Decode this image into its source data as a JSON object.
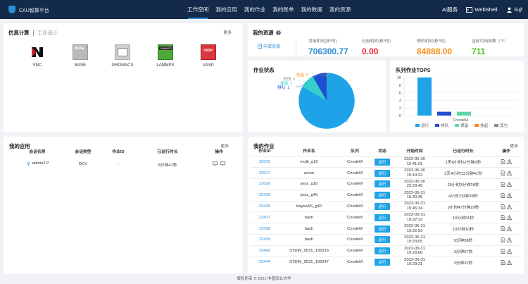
{
  "header": {
    "brand": "CAU智算平台",
    "nav": [
      "工作空间",
      "我的应用",
      "我的作业",
      "我的账单",
      "我的数据",
      "我的资源"
    ],
    "ai_service": "AI服务",
    "webshell": "WebShell",
    "user": "liujf"
  },
  "simulation": {
    "tab_active": "仿真计算",
    "tab_inactive": "工业设计",
    "more": "更多",
    "apps": [
      {
        "name": "VNC",
        "icon": "vnc-icon"
      },
      {
        "name": "BASE",
        "icon": "base-icon"
      },
      {
        "name": "GROMACS",
        "icon": "gromacs-icon"
      },
      {
        "name": "LAMMPS",
        "icon": "lammps-icon"
      },
      {
        "name": "VASP",
        "icon": "vasp-icon"
      }
    ],
    "base_badge": "BASE",
    "lammps_badge": "LAMMPS",
    "vasp_badge": "VASP"
  },
  "resources": {
    "title": "我的资源",
    "apply_link": "申请资源",
    "stats": [
      {
        "label": "可用机时(核*时)",
        "value": "706300.77",
        "color": "#2e8fd8"
      },
      {
        "label": "已用机时(核*时)",
        "value": "0.00",
        "color": "#f5222d"
      },
      {
        "label": "预约机时(核*时)",
        "value": "84888.00",
        "color": "#fa8c16"
      },
      {
        "label": "当前可用核数（个）",
        "value": "711",
        "color": "#52c41a"
      }
    ]
  },
  "job_status": {
    "title": "作业状态",
    "labels": [
      "挂起: 0",
      "其他: 0",
      "保留: 1",
      "排队: 1",
      "运行: 10"
    ],
    "colors": {
      "running": "#1fa3e8",
      "queued": "#1f4fd1",
      "reserved": "#36cfc9",
      "held": "#fa8c16",
      "other": "#8c8c8c"
    }
  },
  "queue_chart": {
    "title": "队列作业TOPS",
    "chart_data": {
      "type": "bar",
      "categories": [
        "CnodeM"
      ],
      "series": [
        {
          "name": "运行",
          "values": [
            10
          ],
          "color": "#1fa3e8"
        },
        {
          "name": "排队",
          "values": [
            1
          ],
          "color": "#1f4fd1"
        },
        {
          "name": "保留",
          "values": [
            1
          ],
          "color": "#5fd6a8"
        },
        {
          "name": "挂起",
          "values": [
            0
          ],
          "color": "#fa8c16"
        },
        {
          "name": "其它",
          "values": [
            0
          ],
          "color": "#8c8c8c"
        }
      ],
      "yticks": [
        "10",
        "8",
        "6",
        "4",
        "2",
        "0"
      ],
      "ylim": [
        0,
        10
      ]
    }
  },
  "my_apps": {
    "title": "我的应用",
    "more": "更多",
    "columns": [
      "会话名称",
      "会话类型",
      "作业ID",
      "已运行时长",
      "操作"
    ],
    "rows": [
      {
        "name": "admin2:2",
        "type": "DCV",
        "job_id": "-",
        "elapsed": "5分钟41秒"
      }
    ]
  },
  "my_jobs": {
    "title": "我的作业",
    "more": "更多",
    "columns": [
      "作业ID",
      "作业名",
      "队列",
      "状态",
      "开始时间",
      "已运行时长",
      "操作"
    ],
    "rows": [
      {
        "id": "22015",
        "name": "multi_g10",
        "queue": "CnodeM",
        "status": "运行",
        "start": "2022-05-30\n12:41:01",
        "elapsed": "1天6小时52分钟2秒"
      },
      {
        "id": "22017",
        "name": "union",
        "queue": "CnodeM",
        "status": "运行",
        "start": "2022-05-30\n15:19:22",
        "elapsed": "1天4小时13分钟41秒"
      },
      {
        "id": "23026",
        "name": "jwas_g10",
        "queue": "CnodeM",
        "status": "运行",
        "start": "2022-05-30\n23:29:45",
        "elapsed": "20小时3分钟18秒"
      },
      {
        "id": "23429",
        "name": "jwas_g40",
        "queue": "CnodeM",
        "status": "运行",
        "start": "2022-05-31\n15:30:35",
        "elapsed": "4小时2分钟28秒"
      },
      {
        "id": "23430",
        "name": "bayesAS_g40",
        "queue": "CnodeM",
        "status": "运行",
        "start": "2022-05-31\n15:45:34",
        "elapsed": "3小时47分钟29秒"
      },
      {
        "id": "23437",
        "name": "bash",
        "queue": "CnodeM",
        "status": "运行",
        "start": "2022-05-31\n19:22:32",
        "elapsed": "10分钟31秒"
      },
      {
        "id": "23438",
        "name": "bash",
        "queue": "CnodeM",
        "status": "运行",
        "start": "2022-05-31\n19:22:53",
        "elapsed": "10分钟10秒"
      },
      {
        "id": "23439",
        "name": "bash",
        "queue": "CnodeM",
        "status": "运行",
        "start": "2022-05-31\n19:23:05",
        "elapsed": "9分钟58秒"
      },
      {
        "id": "23443",
        "name": "STDIN_0531_192916",
        "queue": "CnodeM",
        "status": "运行",
        "start": "2022-05-31\n19:29:06",
        "elapsed": "3分钟57秒"
      },
      {
        "id": "23444",
        "name": "STDIN_0531_192947",
        "queue": "CnodeM",
        "status": "运行",
        "start": "2022-05-31\n19:29:31",
        "elapsed": "3分钟32秒"
      }
    ]
  },
  "footer": "版权所有 © 2021 中国农业大学"
}
